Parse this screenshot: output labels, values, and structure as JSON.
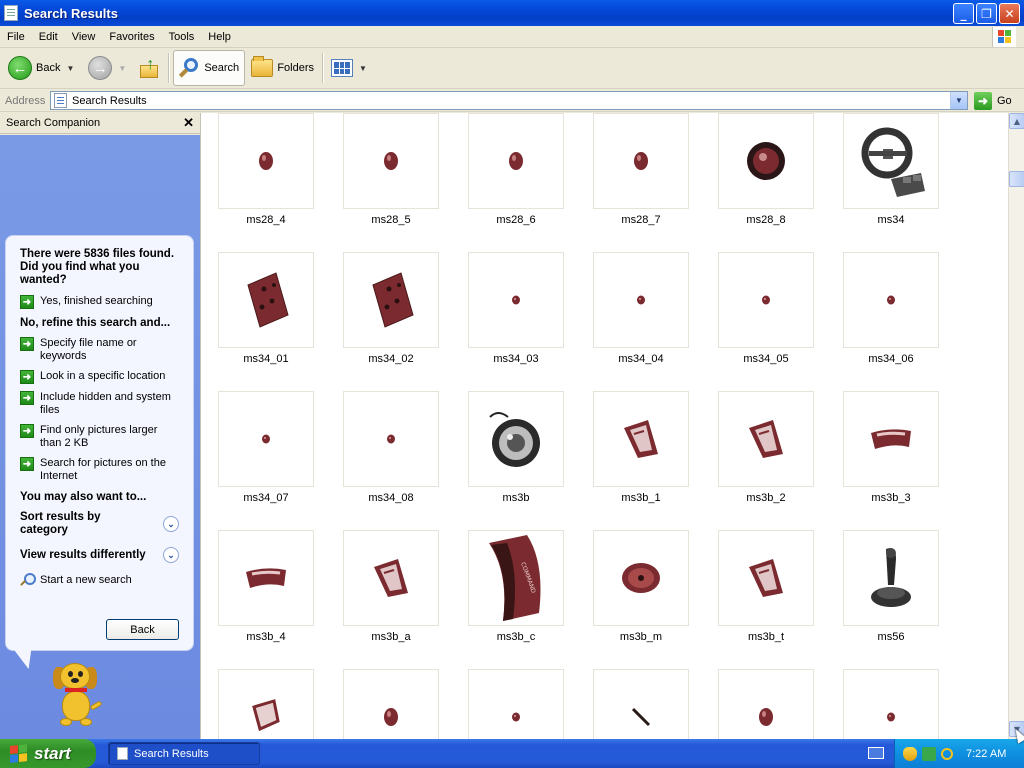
{
  "window": {
    "title": "Search Results"
  },
  "menu": {
    "items": [
      "File",
      "Edit",
      "View",
      "Favorites",
      "Tools",
      "Help"
    ]
  },
  "toolbar": {
    "back_label": "Back",
    "search_label": "Search",
    "folders_label": "Folders"
  },
  "address": {
    "label": "Address",
    "value": "Search Results",
    "go_label": "Go"
  },
  "companion": {
    "header": "Search Companion",
    "question": "There were 5836 files found. Did you find what you wanted?",
    "yes_option": "Yes, finished searching",
    "refine_heading": "No, refine this search and...",
    "refine_options": [
      "Specify file name or keywords",
      "Look in a specific location",
      "Include hidden and system files",
      "Find only pictures larger than 2 KB",
      "Search for pictures on the Internet"
    ],
    "also_heading": "You may also want to...",
    "sort_label": "Sort results by category",
    "view_label": "View results differently",
    "new_search_label": "Start a new search",
    "back_button": "Back"
  },
  "results": {
    "files": [
      {
        "name": "ms28_4",
        "icon": "small-disc"
      },
      {
        "name": "ms28_5",
        "icon": "small-disc"
      },
      {
        "name": "ms28_6",
        "icon": "small-disc"
      },
      {
        "name": "ms28_7",
        "icon": "small-disc"
      },
      {
        "name": "ms28_8",
        "icon": "ring"
      },
      {
        "name": "ms34",
        "icon": "steering-wheel"
      },
      {
        "name": "ms34_01",
        "icon": "panel"
      },
      {
        "name": "ms34_02",
        "icon": "panel"
      },
      {
        "name": "ms34_03",
        "icon": "dot"
      },
      {
        "name": "ms34_04",
        "icon": "dot"
      },
      {
        "name": "ms34_05",
        "icon": "dot"
      },
      {
        "name": "ms34_06",
        "icon": "dot"
      },
      {
        "name": "ms34_07",
        "icon": "dot"
      },
      {
        "name": "ms34_08",
        "icon": "dot"
      },
      {
        "name": "ms3b",
        "icon": "round-device"
      },
      {
        "name": "ms3b_1",
        "icon": "wedge"
      },
      {
        "name": "ms3b_2",
        "icon": "wedge"
      },
      {
        "name": "ms3b_3",
        "icon": "arc"
      },
      {
        "name": "ms3b_4",
        "icon": "arc"
      },
      {
        "name": "ms3b_a",
        "icon": "wedge"
      },
      {
        "name": "ms3b_c",
        "icon": "tall-panel"
      },
      {
        "name": "ms3b_m",
        "icon": "disc"
      },
      {
        "name": "ms3b_t",
        "icon": "wedge"
      },
      {
        "name": "ms56",
        "icon": "joystick"
      },
      {
        "name": "",
        "icon": "bracket"
      },
      {
        "name": "",
        "icon": "small-disc"
      },
      {
        "name": "",
        "icon": "dot"
      },
      {
        "name": "",
        "icon": "stroke"
      },
      {
        "name": "",
        "icon": "small-disc"
      },
      {
        "name": "",
        "icon": "dot"
      }
    ]
  },
  "taskbar": {
    "start_label": "start",
    "task_label": "Search Results",
    "clock": "7:22 AM"
  },
  "colors": {
    "accent": "#7b2b2f",
    "titlebar": "#0a4bd8",
    "companion_bg": "#6c8ae0"
  }
}
